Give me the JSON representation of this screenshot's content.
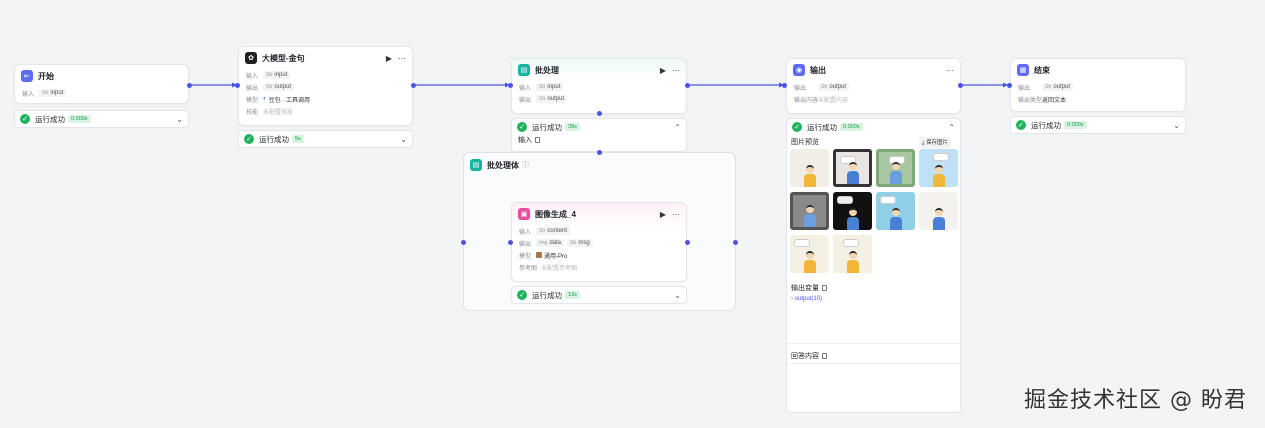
{
  "colors": {
    "accent": "#4d53e8",
    "success": "#1fb35c",
    "llm": "#1f1f1f",
    "batch": "#17b3a3",
    "image": "#e64c9b",
    "output": "#5b6cf0",
    "end": "#5b6cf0"
  },
  "nodes": {
    "start": {
      "title": "开始",
      "in_label": "输入",
      "in_tag_type": "Str",
      "in_tag": "input",
      "status": "运行成功",
      "time": "0.000s"
    },
    "llm": {
      "title": "大模型-金句",
      "in_label": "输入",
      "in_tag_type": "Str",
      "in_tag": "input",
      "out_label": "输出",
      "out_tag_type": "Str",
      "out_tag": "output",
      "model_label": "模型",
      "model_value": "豆包 · 工具调用",
      "skill_label": "技能",
      "skill_value": "未配置技能",
      "status": "运行成功",
      "time": "5s"
    },
    "batch": {
      "title": "批处理",
      "in_label": "输入",
      "in_tag_type": "Str",
      "in_tag": "input",
      "out_label": "输出",
      "out_tag_type": "Str",
      "out_tag": "output",
      "status": "运行成功",
      "time": "39s",
      "io_label": "输入"
    },
    "batch_body": {
      "title": "批处理体",
      "info": "ⓘ"
    },
    "image_gen": {
      "title": "图像生成_4",
      "in_label": "输入",
      "in_tag_type": "Str",
      "in_tag": "content",
      "out_label": "输出",
      "out_tag_type": "Img",
      "out_tag": "data",
      "out_tag2_type": "Str",
      "out_tag2": "msg",
      "model_label": "模型",
      "model_value": "通用-Pro",
      "ref_label": "参考图",
      "ref_value": "未配置参考图",
      "status": "运行成功",
      "time": "13s"
    },
    "output": {
      "title": "输出",
      "in_label": "输出",
      "in_tag_type": "Str",
      "in_tag": "output",
      "content_label": "输出内容",
      "content_value": "未配置内容",
      "status": "运行成功",
      "time": "0.000s",
      "preview_label": "图片预览",
      "save_label": "保存图片",
      "vars_label": "输出变量",
      "vars_item": "› output(10)",
      "answer_label": "回答内容"
    },
    "end": {
      "title": "结束",
      "in_label": "输出",
      "in_tag_type": "Str",
      "in_tag": "output",
      "mode_label": "输出类型",
      "mode_value": "返回文本",
      "status": "运行成功",
      "time": "0.000s"
    }
  },
  "watermark": "掘金技术社区 @ 盼君"
}
